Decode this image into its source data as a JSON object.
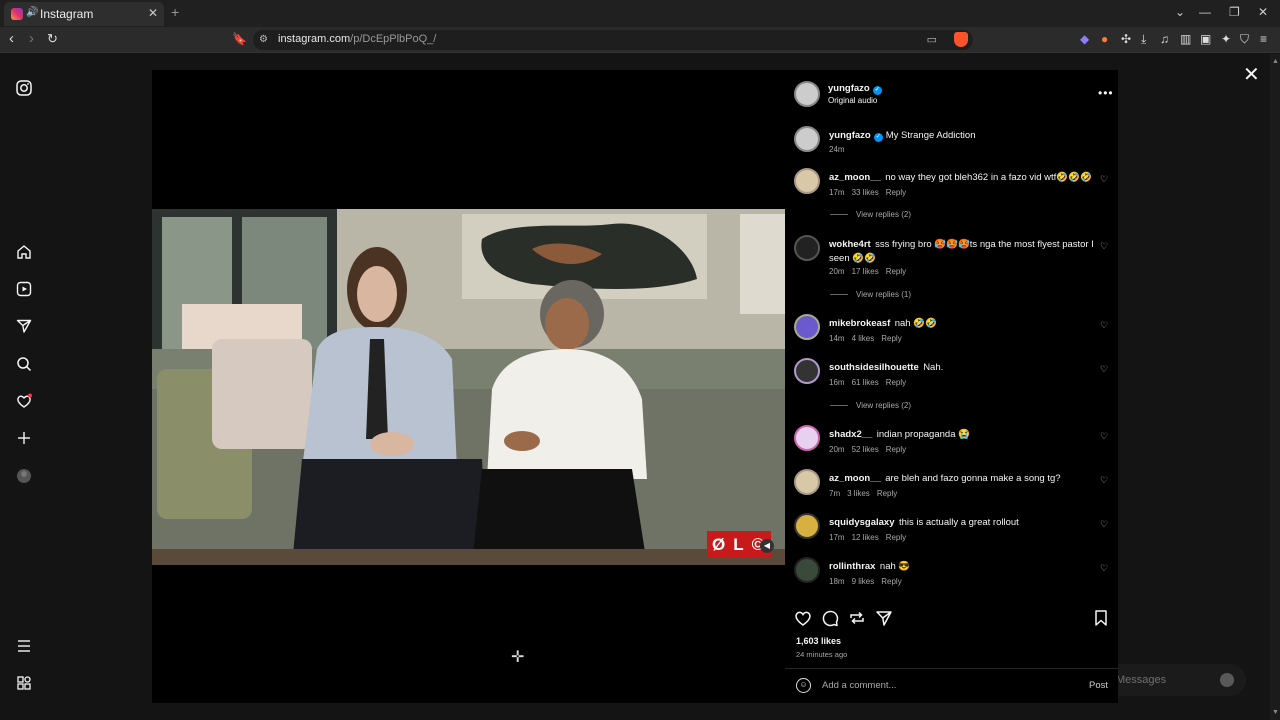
{
  "browser": {
    "tab_title": "Instagram",
    "tab_audio_icon": "speaker-icon",
    "url_host": "instagram.com",
    "url_path": "/p/DcEpPlbPoQ_/"
  },
  "post_header": {
    "username": "yungfazo",
    "subtitle": "Original audio"
  },
  "caption": {
    "username": "yungfazo",
    "text": "My Strange Addiction",
    "time": "24m"
  },
  "video": {
    "watermark": "ØL©"
  },
  "comments": [
    {
      "user": "az_moon__",
      "text": "no way they got bleh362 in a fazo vid wtf🤣🤣🤣",
      "time": "17m",
      "likes": "33 likes",
      "reply": "Reply",
      "view_replies": "View replies (2)"
    },
    {
      "user": "wokhe4rt",
      "text": "sss frying bro 🥵🥵🥵ts nga the most flyest pastor I seen 🤣🤣",
      "time": "20m",
      "likes": "17 likes",
      "reply": "Reply",
      "view_replies": "View replies (1)"
    },
    {
      "user": "mikebrokeasf",
      "text": "nah 🤣🤣",
      "time": "14m",
      "likes": "4 likes",
      "reply": "Reply"
    },
    {
      "user": "southsidesilhouette",
      "text": "Nah.",
      "time": "16m",
      "likes": "61 likes",
      "reply": "Reply",
      "view_replies": "View replies (2)"
    },
    {
      "user": "shadx2__",
      "text": "indian propaganda 😭",
      "time": "20m",
      "likes": "52 likes",
      "reply": "Reply"
    },
    {
      "user": "az_moon__",
      "text": "are bleh and fazo gonna make a song tg?",
      "time": "7m",
      "likes": "3 likes",
      "reply": "Reply"
    },
    {
      "user": "squidysgalaxy",
      "text": "this is actually a great rollout",
      "time": "17m",
      "likes": "12 likes",
      "reply": "Reply"
    },
    {
      "user": "rollinthrax",
      "text": "nah 😎",
      "time": "18m",
      "likes": "9 likes",
      "reply": "Reply"
    }
  ],
  "stats": {
    "likes": "1,603 likes",
    "posted": "24 minutes ago"
  },
  "add_comment": {
    "placeholder": "Add a comment...",
    "post_label": "Post"
  },
  "messages": {
    "label": "Messages"
  },
  "colors": {
    "accent": "#0095f6",
    "watermark": "#c81a1a"
  }
}
